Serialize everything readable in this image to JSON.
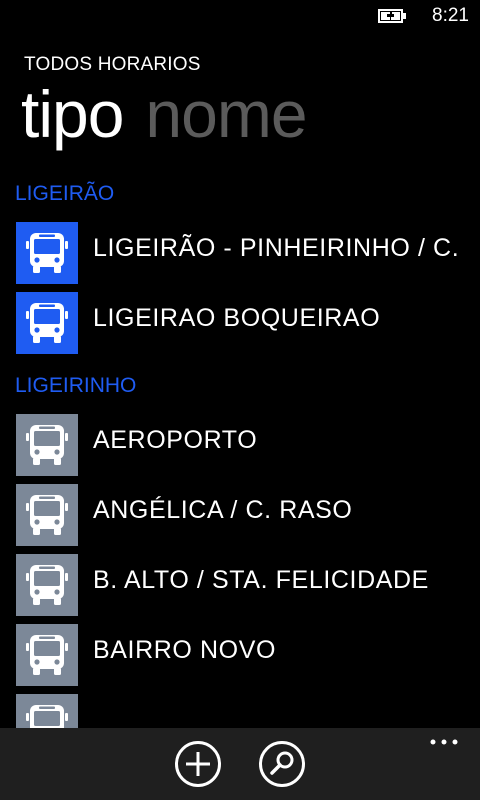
{
  "status_bar": {
    "time": "8:21",
    "battery_icon": "battery-charging-icon"
  },
  "header": {
    "app_title": "TODOS HORARIOS",
    "pivot_tabs": [
      {
        "label": "tipo",
        "active": true
      },
      {
        "label": "nome",
        "active": false
      }
    ]
  },
  "groups": [
    {
      "name": "LIGEIRÃO",
      "tile_color": "#1f5cf2",
      "routes": [
        "LIGEIRÃO - PINHEIRINHO / C. GOMES",
        "LIGEIRAO BOQUEIRAO"
      ]
    },
    {
      "name": "LIGEIRINHO",
      "tile_color": "#7c8898",
      "routes": [
        "AEROPORTO",
        "ANGÉLICA / C. RASO",
        "B. ALTO / STA. FELICIDADE",
        "BAIRRO NOVO",
        ""
      ]
    }
  ],
  "app_bar": {
    "buttons": [
      {
        "icon": "add-icon"
      },
      {
        "icon": "search-icon"
      }
    ],
    "more_icon": "more-icon"
  },
  "colors": {
    "accent": "#1f5cf2",
    "inactive_tile": "#7c8898",
    "background": "#000000",
    "app_bar": "#1f1f1f",
    "inactive_pivot": "#5b5b5b"
  }
}
